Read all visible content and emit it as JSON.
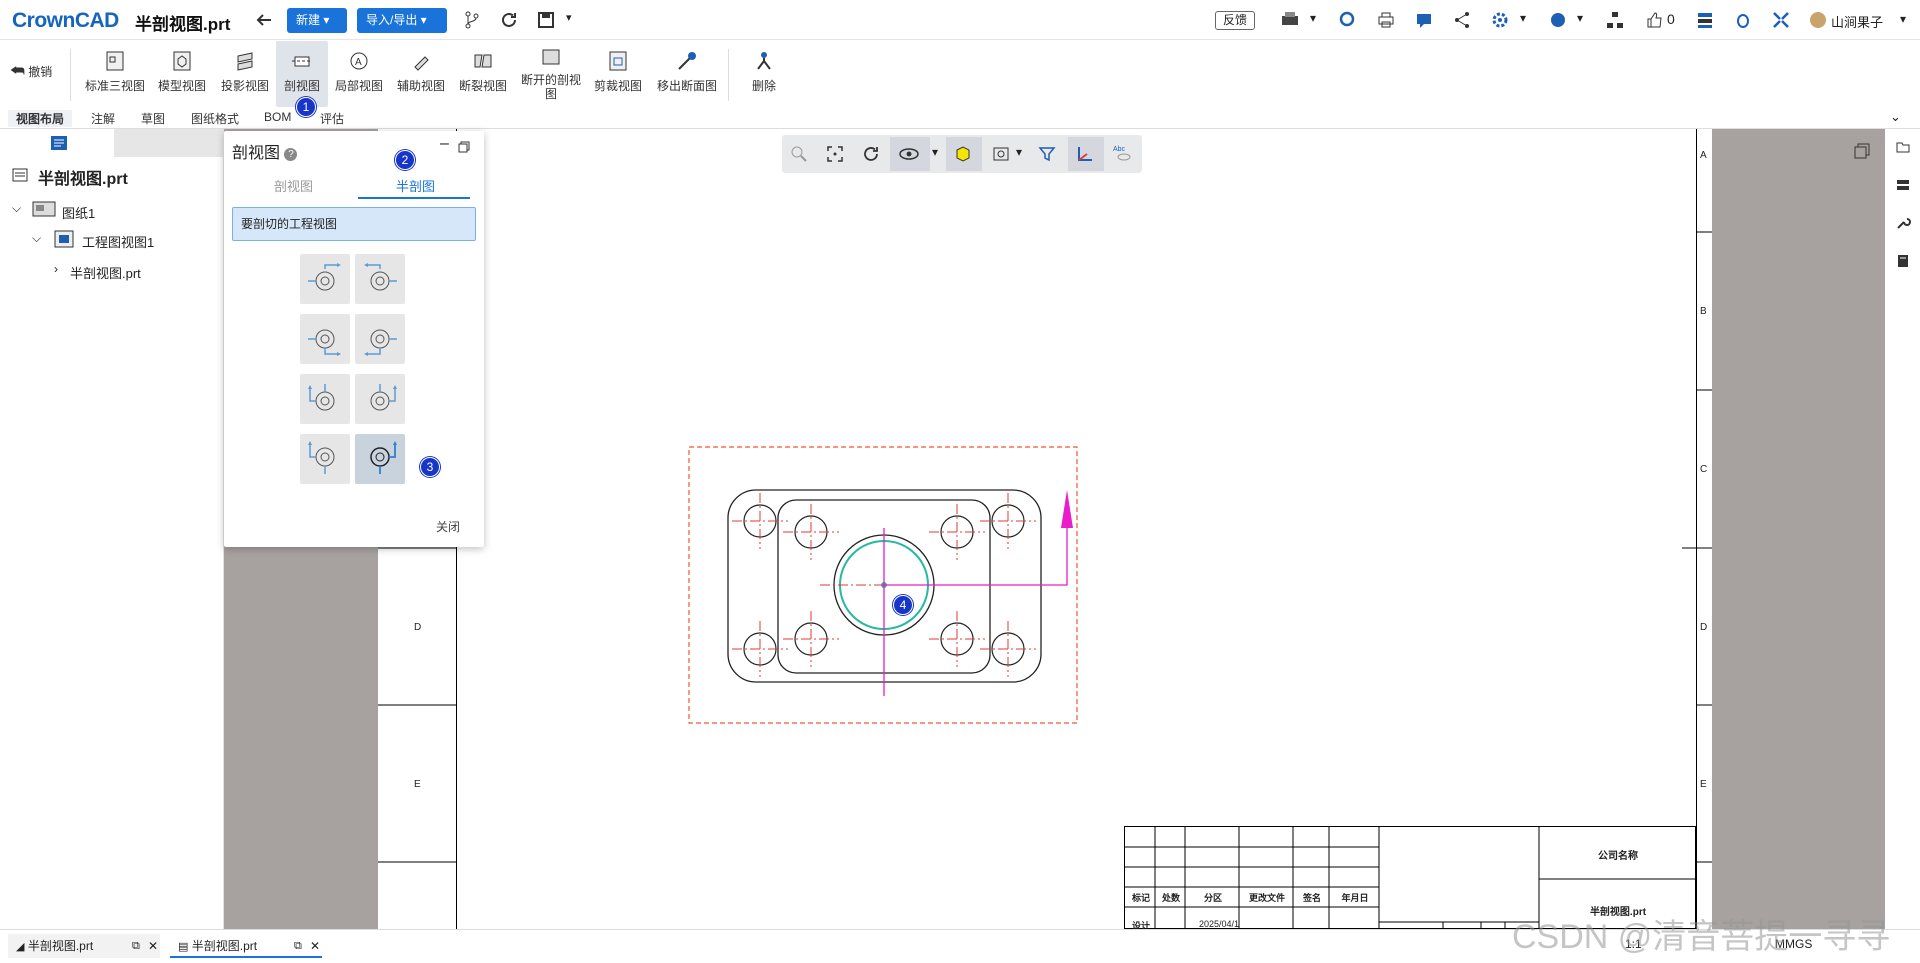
{
  "header": {
    "logo": "CrownCAD",
    "doc_title": "半剖视图.prt",
    "new_btn": "新建",
    "import_btn": "导入/导出",
    "feedback": "反馈",
    "likes": "0",
    "user": "山涧果子"
  },
  "ribbon": {
    "undo": "撤销",
    "items": [
      "标准三视图",
      "模型视图",
      "投影视图",
      "剖视图",
      "局部视图",
      "辅助视图",
      "断裂视图",
      "断开的剖视\n图",
      "剪裁视图",
      "移出断面图"
    ],
    "delete": "删除"
  },
  "tabs": [
    "视图布局",
    "注解",
    "草图",
    "图纸格式",
    "BOM",
    "评估"
  ],
  "tree": {
    "root": "半剖视图.prt",
    "sheet": "图纸1",
    "view": "工程图视图1",
    "part": "半剖视图.prt"
  },
  "dialog": {
    "title": "剖视图",
    "tab_section": "剖视图",
    "tab_half": "半剖图",
    "prompt": "要剖切的工程视图",
    "close": "关闭"
  },
  "badges": [
    "1",
    "2",
    "3",
    "4"
  ],
  "zones_right": [
    "A",
    "B",
    "C",
    "D",
    "E"
  ],
  "zones_left": [
    "D",
    "E"
  ],
  "title_block": {
    "company": "公司名称",
    "part_name": "半剖视图.prt",
    "headers": [
      "标记",
      "处数",
      "分区",
      "更改文件",
      "签名",
      "年月日"
    ],
    "row_label": "设计",
    "date": "2025/04/1",
    "scale": "1:1",
    "units": "MMGS"
  },
  "bottom_tabs": [
    "半剖视图.prt",
    "半剖视图.prt"
  ],
  "watermark": "CSDN @清音菩提一寻寻",
  "colors": {
    "accent": "#1a73d9",
    "centerline": "#e53935",
    "section": "#e91ec8",
    "circle": "#26b8a0",
    "badge": "#1736c9"
  }
}
